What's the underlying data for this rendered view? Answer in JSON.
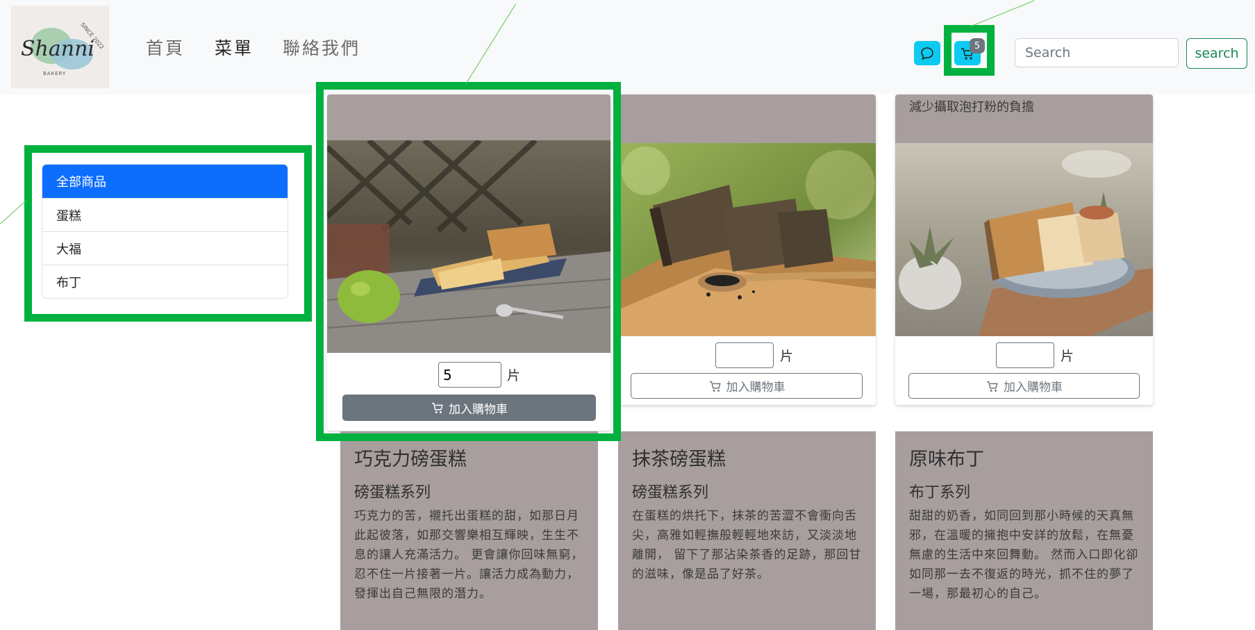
{
  "brand": {
    "script": "Shanni",
    "since": "SINCE 2022",
    "sub": "BAKERY"
  },
  "nav": {
    "home": "首頁",
    "menu": "菜單",
    "contact": "聯絡我們"
  },
  "cart": {
    "count": "5"
  },
  "search": {
    "placeholder": "Search",
    "button_label": "search"
  },
  "categories": [
    "全部商品",
    "蛋糕",
    "大福",
    "布丁"
  ],
  "products": [
    {
      "image": "lemon-pound-cake-photo",
      "quantity": "5",
      "unit": "片",
      "add_label": "加入購物車"
    },
    {
      "image": "matcha-pound-cake-photo",
      "quantity": "",
      "unit": "片",
      "add_label": "加入購物車"
    },
    {
      "image": "plain-pound-cake-photo",
      "top_text": "減少攝取泡打粉的負擔",
      "quantity": "",
      "unit": "片",
      "add_label": "加入購物車"
    }
  ],
  "descriptions": [
    {
      "title": "巧克力磅蛋糕",
      "series": "磅蛋糕系列",
      "text": "巧克力的苦，襯托出蛋糕的甜，如那日月此起彼落，如那交響樂相互輝映，生生不息的讓人充滿活力。 更會讓你回味無窮，忍不住一片接著一片。讓活力成為動力，發揮出自己無限的潛力。"
    },
    {
      "title": "抹茶磅蛋糕",
      "series": "磅蛋糕系列",
      "text": "在蛋糕的烘托下，抹茶的苦澀不會衝向舌尖，高雅如輕撫般輕輕地來訪，又淡淡地離開， 留下了那沾染茶香的足跡，那回甘的滋味，像是品了好茶。"
    },
    {
      "title": "原味布丁",
      "series": "布丁系列",
      "text": "甜甜的奶香，如同回到那小時候的天真無邪，在溫暖的擁抱中安詳的放鬆，在無憂無慮的生活中來回舞動。 然而入口即化卻如同那一去不復返的時光，抓不住的夢了一場，那最初心的自己。"
    }
  ],
  "colors": {
    "highlight": "#00b140",
    "primary": "#0d6efd",
    "info": "#0dcaf0",
    "success": "#198754",
    "secondary": "#6c757d",
    "card_bg": "#a89e9e"
  }
}
